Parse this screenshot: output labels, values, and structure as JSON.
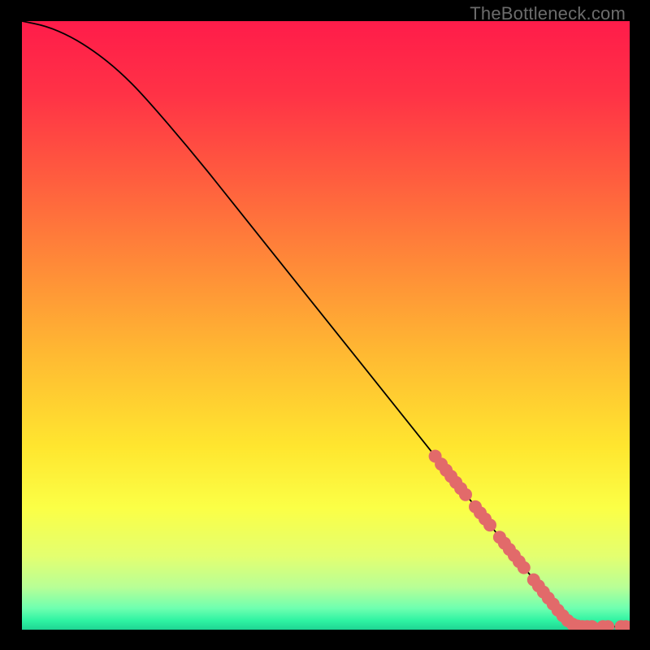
{
  "watermark": "TheBottleneck.com",
  "colors": {
    "marker": "#e26a6a",
    "curve": "#000000"
  },
  "chart_data": {
    "type": "line",
    "title": "",
    "xlabel": "",
    "ylabel": "",
    "xlim": [
      0,
      100
    ],
    "ylim": [
      0,
      100
    ],
    "curve": [
      {
        "x": 0,
        "y": 100
      },
      {
        "x": 4,
        "y": 99.2
      },
      {
        "x": 8,
        "y": 97.5
      },
      {
        "x": 12,
        "y": 95.0
      },
      {
        "x": 16,
        "y": 91.8
      },
      {
        "x": 20,
        "y": 87.8
      },
      {
        "x": 28,
        "y": 78.5
      },
      {
        "x": 36,
        "y": 68.5
      },
      {
        "x": 44,
        "y": 58.5
      },
      {
        "x": 52,
        "y": 48.5
      },
      {
        "x": 60,
        "y": 38.5
      },
      {
        "x": 68,
        "y": 28.5
      },
      {
        "x": 72,
        "y": 23.5
      },
      {
        "x": 76,
        "y": 18.5
      },
      {
        "x": 80,
        "y": 13.5
      },
      {
        "x": 84,
        "y": 8.5
      },
      {
        "x": 88,
        "y": 3.5
      },
      {
        "x": 90.5,
        "y": 0.8
      },
      {
        "x": 92,
        "y": 0.5
      },
      {
        "x": 96,
        "y": 0.5
      },
      {
        "x": 100,
        "y": 0.5
      }
    ],
    "markers": [
      {
        "x": 68.0,
        "y": 28.5,
        "r": 1.0
      },
      {
        "x": 69.0,
        "y": 27.2,
        "r": 1.0
      },
      {
        "x": 69.8,
        "y": 26.2,
        "r": 1.0
      },
      {
        "x": 70.6,
        "y": 25.2,
        "r": 1.0
      },
      {
        "x": 71.4,
        "y": 24.2,
        "r": 1.0
      },
      {
        "x": 72.2,
        "y": 23.2,
        "r": 1.0
      },
      {
        "x": 73.0,
        "y": 22.2,
        "r": 1.0
      },
      {
        "x": 74.6,
        "y": 20.2,
        "r": 1.0
      },
      {
        "x": 75.4,
        "y": 19.2,
        "r": 1.0
      },
      {
        "x": 76.2,
        "y": 18.2,
        "r": 1.0
      },
      {
        "x": 77.0,
        "y": 17.2,
        "r": 1.0
      },
      {
        "x": 78.6,
        "y": 15.2,
        "r": 1.0
      },
      {
        "x": 79.4,
        "y": 14.2,
        "r": 1.0
      },
      {
        "x": 80.2,
        "y": 13.2,
        "r": 1.0
      },
      {
        "x": 81.0,
        "y": 12.2,
        "r": 1.0
      },
      {
        "x": 81.8,
        "y": 11.2,
        "r": 1.0
      },
      {
        "x": 82.6,
        "y": 10.2,
        "r": 1.0
      },
      {
        "x": 84.2,
        "y": 8.2,
        "r": 1.0
      },
      {
        "x": 85.0,
        "y": 7.2,
        "r": 1.0
      },
      {
        "x": 85.8,
        "y": 6.2,
        "r": 1.0
      },
      {
        "x": 86.6,
        "y": 5.2,
        "r": 1.0
      },
      {
        "x": 87.4,
        "y": 4.2,
        "r": 1.0
      },
      {
        "x": 88.2,
        "y": 3.2,
        "r": 1.0
      },
      {
        "x": 89.0,
        "y": 2.3,
        "r": 1.0
      },
      {
        "x": 89.8,
        "y": 1.5,
        "r": 1.0
      },
      {
        "x": 90.6,
        "y": 0.9,
        "r": 1.0
      },
      {
        "x": 91.4,
        "y": 0.6,
        "r": 1.0
      },
      {
        "x": 92.2,
        "y": 0.5,
        "r": 1.0
      },
      {
        "x": 93.0,
        "y": 0.5,
        "r": 1.0
      },
      {
        "x": 93.8,
        "y": 0.5,
        "r": 1.0
      },
      {
        "x": 95.6,
        "y": 0.5,
        "r": 1.0
      },
      {
        "x": 96.4,
        "y": 0.5,
        "r": 1.0
      },
      {
        "x": 98.6,
        "y": 0.5,
        "r": 1.0
      },
      {
        "x": 99.4,
        "y": 0.5,
        "r": 1.0
      }
    ],
    "gradient_stops": [
      {
        "offset": 0.0,
        "color": "#ff1c4a"
      },
      {
        "offset": 0.12,
        "color": "#ff3246"
      },
      {
        "offset": 0.25,
        "color": "#ff5a3f"
      },
      {
        "offset": 0.4,
        "color": "#ff8a38"
      },
      {
        "offset": 0.55,
        "color": "#ffba32"
      },
      {
        "offset": 0.7,
        "color": "#ffe62f"
      },
      {
        "offset": 0.8,
        "color": "#fbff46"
      },
      {
        "offset": 0.88,
        "color": "#e3ff70"
      },
      {
        "offset": 0.93,
        "color": "#b8ff96"
      },
      {
        "offset": 0.965,
        "color": "#6effb0"
      },
      {
        "offset": 0.985,
        "color": "#2ef3a2"
      },
      {
        "offset": 1.0,
        "color": "#1fd593"
      }
    ]
  }
}
